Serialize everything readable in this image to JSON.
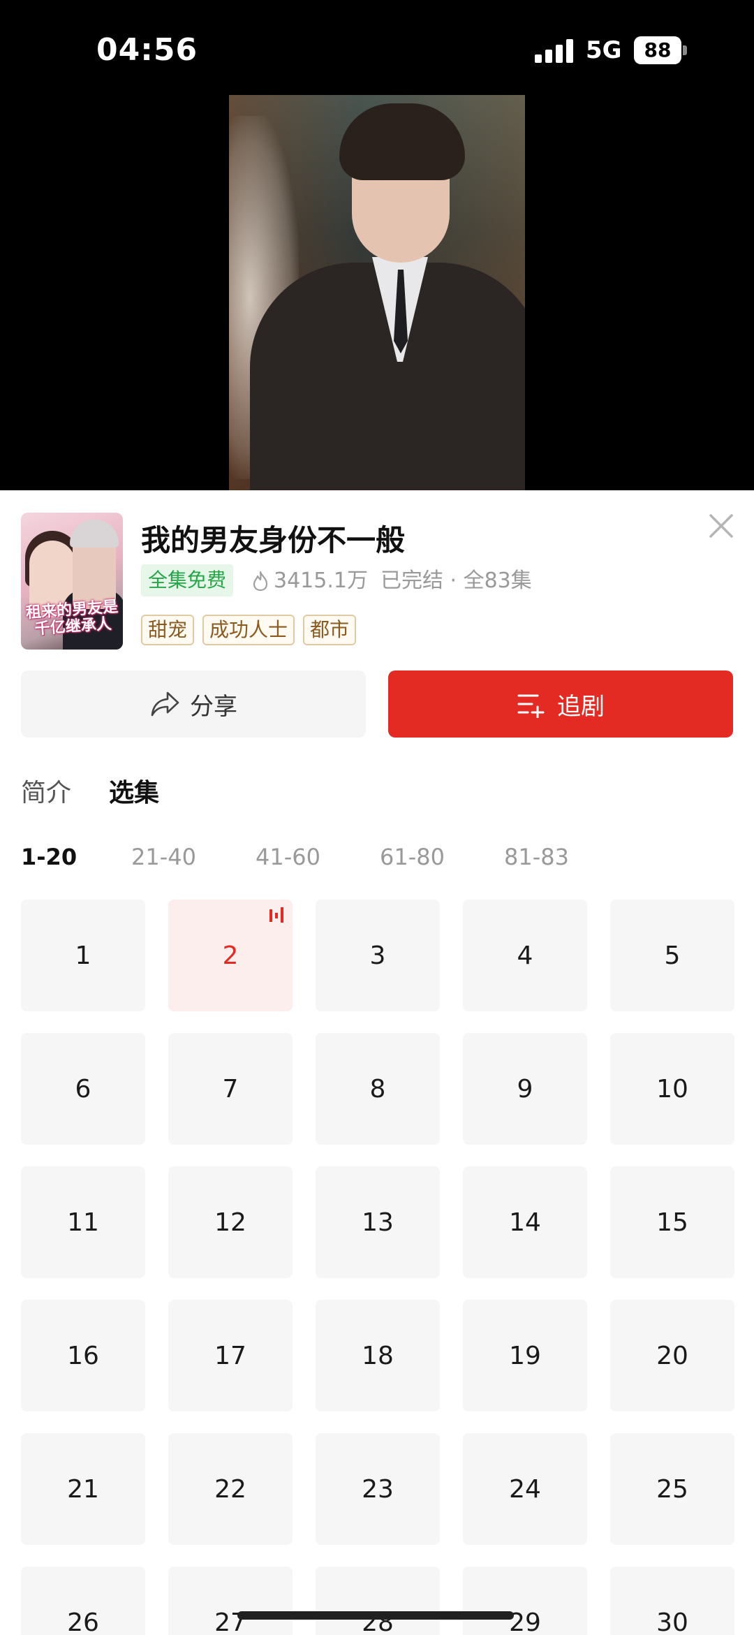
{
  "status_bar": {
    "time": "04:56",
    "network": "5G",
    "battery": "88"
  },
  "drama": {
    "title": "我的男友身份不一般",
    "cover_text": "租来的男友是千亿继承人",
    "free_badge": "全集免费",
    "plays": "3415.1万",
    "status": "已完结 · 全83集",
    "tags": [
      "甜宠",
      "成功人士",
      "都市"
    ]
  },
  "actions": {
    "share_label": "分享",
    "follow_label": "追剧"
  },
  "tabs": {
    "intro": "简介",
    "episodes": "选集"
  },
  "ranges": [
    "1-20",
    "21-40",
    "41-60",
    "61-80",
    "81-83"
  ],
  "active_range": "1-20",
  "current_episode": 2,
  "episodes": [
    "1",
    "2",
    "3",
    "4",
    "5",
    "6",
    "7",
    "8",
    "9",
    "10",
    "11",
    "12",
    "13",
    "14",
    "15",
    "16",
    "17",
    "18",
    "19",
    "20",
    "21",
    "22",
    "23",
    "24",
    "25",
    "26",
    "27",
    "28",
    "29",
    "30"
  ],
  "colors": {
    "accent_red": "#e32b24",
    "free_green": "#25a547",
    "tag_brown": "#8a5a1f"
  },
  "icons": [
    "signal-icon",
    "battery-icon",
    "close-icon",
    "flame-icon",
    "share-icon",
    "add-to-list-icon",
    "playing-icon"
  ]
}
